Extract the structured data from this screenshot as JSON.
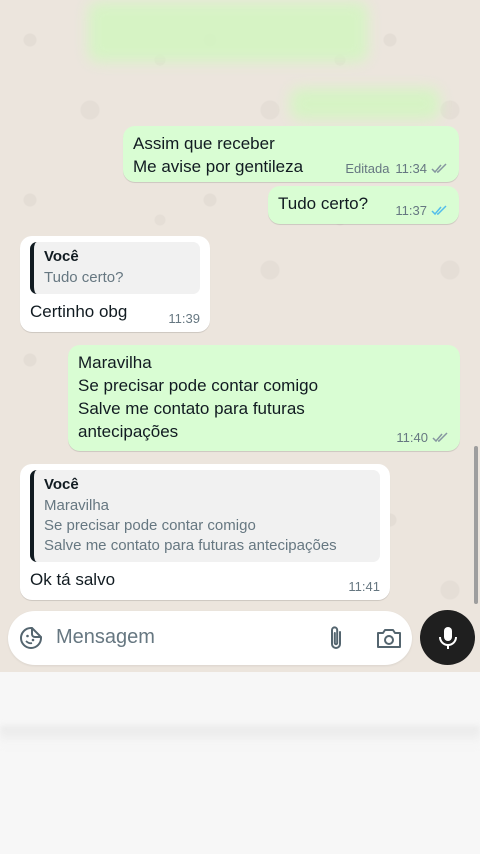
{
  "messages": [
    {
      "direction": "out",
      "text": "Assim que receber\nMe avise por gentileza",
      "edited_label": "Editada",
      "time": "11:34",
      "status": "read"
    },
    {
      "direction": "out",
      "text": "Tudo certo?",
      "time": "11:37",
      "status": "read-blue"
    },
    {
      "direction": "in",
      "quote_author": "Você",
      "quote_text": "Tudo certo?",
      "text": "Certinho obg",
      "time": "11:39"
    },
    {
      "direction": "out",
      "text": "Maravilha\nSe precisar pode contar comigo\nSalve me contato para futuras\nantecipações",
      "time": "11:40",
      "status": "read"
    },
    {
      "direction": "in",
      "quote_author": "Você",
      "quote_text": "Maravilha\nSe precisar pode contar comigo\nSalve me contato para futuras antecipações",
      "text": "Ok tá salvo",
      "time": "11:41"
    }
  ],
  "composer": {
    "placeholder": "Mensagem",
    "icons": [
      "sticker-icon",
      "attach-icon",
      "camera-icon",
      "mic-icon"
    ]
  },
  "colors": {
    "outgoing_bubble": "#d9fdd3",
    "incoming_bubble": "#ffffff",
    "tick_blue": "#53bdeb",
    "tick_gray": "#8696a0",
    "mic_button": "#1f1f1f"
  }
}
